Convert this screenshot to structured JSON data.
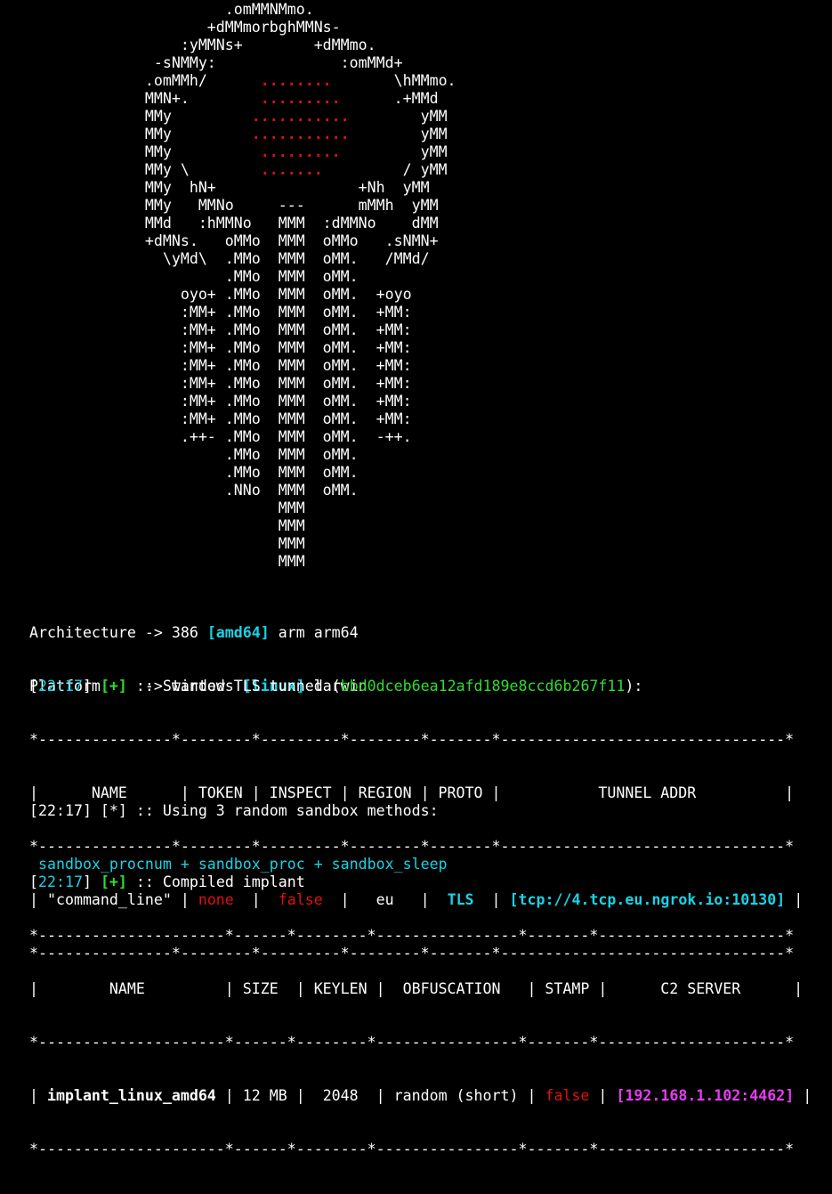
{
  "art": {
    "lines": [
      "                      .omMMNMmo.",
      "                    +dMMmorbghMMNs-",
      "                 :yMMNs+        +dMMmo.",
      "              -sNMMy:              :omMMd+",
      "             .omMMh/      ",
      "             MMN+.        ",
      "             MMy          ",
      "             MMy          ",
      "             MMy          ",
      "             MMy \\        ",
      "             MMy  hN+                +Nh  yMM",
      "             MMy   MMNo     ---      mMMh  yMM",
      "             MMd   :hMMNo   MMM  :dMMNo    dMM",
      "             +dMNs.   oMMo  MMM  oMMo   .sNMN+",
      "               \\yMd\\  .MMo  MMM  oMM.   /MMd/",
      "                      .MMo  MMM  oMM.",
      "                 oyo+ .MMo  MMM  oMM.  +oyo",
      "                 :MM+ .MMo  MMM  oMM.  +MM:",
      "                 :MM+ .MMo  MMM  oMM.  +MM:",
      "                 :MM+ .MMo  MMM  oMM.  +MM:",
      "                 :MM+ .MMo  MMM  oMM.  +MM:",
      "                 :MM+ .MMo  MMM  oMM.  +MM:",
      "                 :MM+ .MMo  MMM  oMM.  +MM:",
      "                 :MM+ .MMo  MMM  oMM.  +MM:",
      "                 .++- .MMo  MMM  oMM.  -++.",
      "                      .MMo  MMM  oMM.",
      "                      .MMo  MMM  oMM.",
      "                      .NNo  MMM  oMM.",
      "                            MMM",
      "                            MMM",
      "                            MMM",
      "                            MMM"
    ],
    "red_rows": [
      {
        "pre": "             .omMMh/      ",
        "dots": "........",
        "post": "       \\hMMmo."
      },
      {
        "pre": "             MMN+.        ",
        "dots": ".........",
        "post": "      .+MMd"
      },
      {
        "pre": "             MMy         ",
        "dots": "...........",
        "post": "        yMM"
      },
      {
        "pre": "             MMy         ",
        "dots": "...........",
        "post": "        yMM"
      },
      {
        "pre": "             MMy          ",
        "dots": ".........",
        "post": "         yMM"
      },
      {
        "pre": "             MMy \\        ",
        "dots": ".......",
        "post": "         / yMM"
      }
    ]
  },
  "arch": {
    "label": "Architecture -> 386 ",
    "selected": "[amd64]",
    "rest": " arm arm64"
  },
  "platform": {
    "label": "Platform     -> windows ",
    "selected": "[linux]",
    "rest": " darwin"
  },
  "tunnel_msg": {
    "open": "[",
    "time": "22:17",
    "close": "] ",
    "tag": "[+]",
    "text": " :: Started TLS tunnel (",
    "id": "bbd0dceb6ea12afd189e8ccd6b267f11",
    "end": "):"
  },
  "tunnel_table": {
    "border": "*---------------*--------*---------*--------*-------*--------------------------------*",
    "header": "|      NAME      | TOKEN | INSPECT | REGION | PROTO |           TUNNEL ADDR          |",
    "row": {
      "c1": "| \"command_line\" | ",
      "token": "none",
      "c2": "  |  ",
      "inspect": "false",
      "c3": "  |   eu   |  ",
      "proto": "TLS",
      "c4": "  | ",
      "addr": "[tcp://4.tcp.eu.ngrok.io:10130]",
      "c5": " |"
    }
  },
  "sandbox_msg": {
    "text": "[22:17] [*] :: Using 3 random sandbox methods:",
    "methods": " sandbox_procnum + sandbox_proc + sandbox_sleep"
  },
  "compiled_msg": {
    "open": "[",
    "time": "22:17",
    "close": "] ",
    "tag": "[+]",
    "text": " :: Compiled implant"
  },
  "implant_table": {
    "border": "*---------------------*------*--------*----------------*-------*---------------------*",
    "header": "|        NAME         | SIZE  | KEYLEN |  OBFUSCATION   | STAMP |      C2 SERVER      |",
    "row": {
      "c1": "| ",
      "name": "implant_linux_amd64",
      "c2": " | 12 MB |  2048  | random (short) | ",
      "stamp": "false",
      "c3": " | ",
      "server": "[192.168.1.102:4462]",
      "c4": " |"
    }
  },
  "colors": {
    "background": "#000000",
    "text": "#ffffff",
    "red": "#e01010",
    "cyan": "#19d3e6",
    "green": "#2fdc2f",
    "magenta": "#e63cf0"
  }
}
